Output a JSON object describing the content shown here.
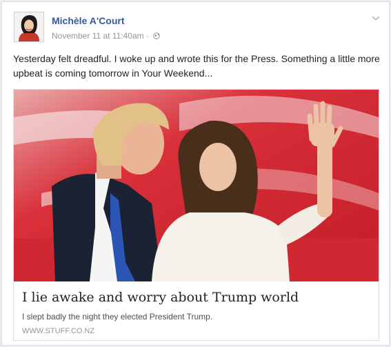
{
  "post": {
    "author": "Michèle A'Court",
    "timestamp": "November 11 at 11:40am",
    "separator": " · ",
    "audience_icon": "globe-icon",
    "menu_icon": "chevron-down-icon",
    "text": "Yesterday felt dreadful. I woke up and wrote this for the Press. Something a little more upbeat is coming tomorrow in Your Weekend..."
  },
  "link": {
    "headline": "I lie awake and worry about Trump world",
    "description": "I slept badly the night they elected President Trump.",
    "domain": "WWW.STUFF.CO.NZ"
  },
  "colors": {
    "name_blue": "#365899",
    "meta_grey": "#90949c",
    "flag_red": "#c8262f",
    "background": "#e9ebee"
  }
}
